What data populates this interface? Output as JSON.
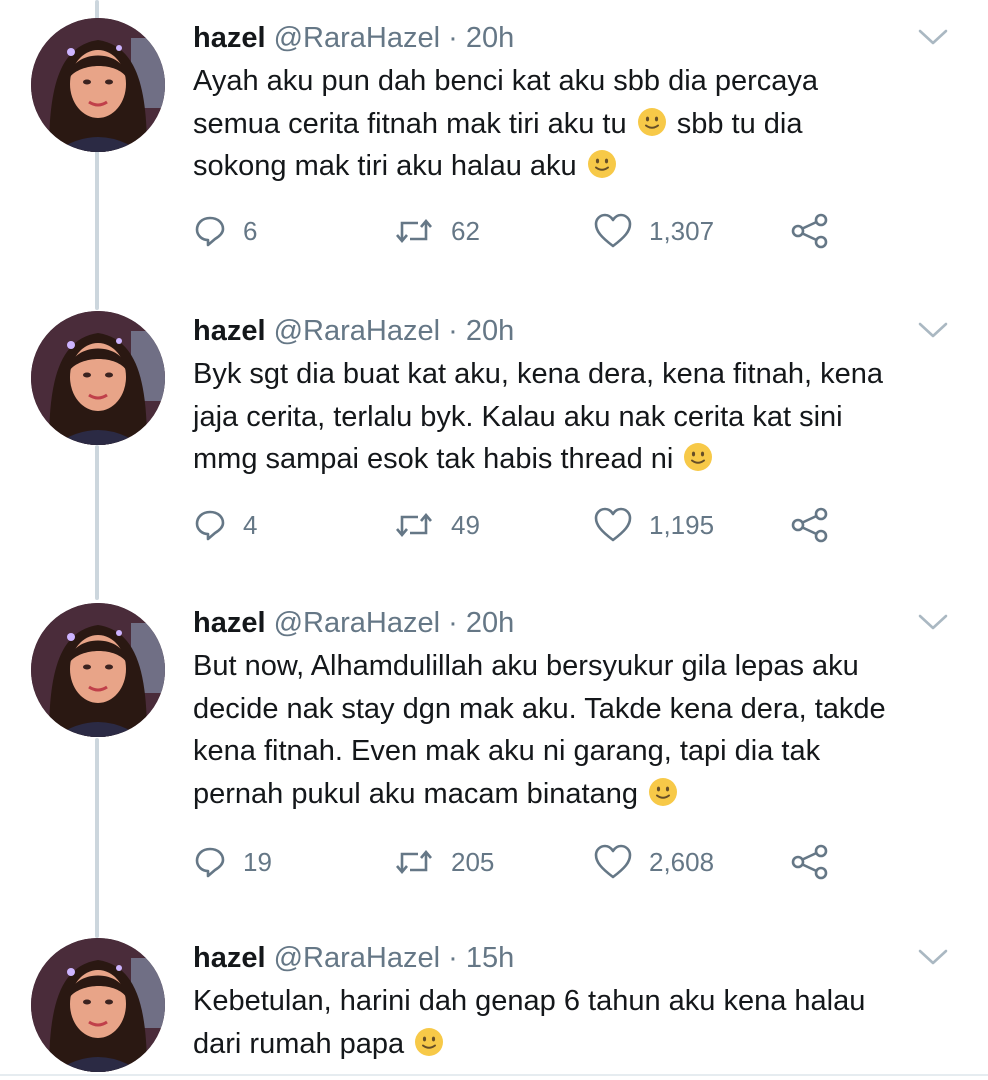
{
  "tweets": [
    {
      "name": "hazel",
      "handle": "@RaraHazel",
      "separator": "·",
      "time": "20h",
      "lines": [
        {
          "text": "Ayah aku pun dah benci kat aku sbb dia percaya",
          "emoji": "",
          "after": ""
        },
        {
          "text": "semua cerita fitnah mak tiri aku tu ",
          "emoji": "slightly-smiling-face",
          "after": " sbb tu dia"
        },
        {
          "text": "sokong mak tiri aku halau aku ",
          "emoji": "slightly-smiling-face",
          "after": ""
        }
      ],
      "replies": "6",
      "retweets": "62",
      "likes": "1,307"
    },
    {
      "name": "hazel",
      "handle": "@RaraHazel",
      "separator": "·",
      "time": "20h",
      "lines": [
        {
          "text": "Byk sgt dia buat kat aku, kena dera, kena fitnah, kena",
          "emoji": "",
          "after": ""
        },
        {
          "text": "jaja cerita, terlalu byk. Kalau aku nak cerita kat sini",
          "emoji": "",
          "after": ""
        },
        {
          "text": "mmg sampai esok tak habis thread ni ",
          "emoji": "slightly-smiling-face",
          "after": ""
        }
      ],
      "replies": "4",
      "retweets": "49",
      "likes": "1,195"
    },
    {
      "name": "hazel",
      "handle": "@RaraHazel",
      "separator": "·",
      "time": "20h",
      "lines": [
        {
          "text": "But now, Alhamdulillah aku bersyukur gila lepas aku",
          "emoji": "",
          "after": ""
        },
        {
          "text": "decide nak stay dgn mak aku. Takde kena dera, takde",
          "emoji": "",
          "after": ""
        },
        {
          "text": "kena fitnah. Even mak aku ni garang, tapi dia tak",
          "emoji": "",
          "after": ""
        },
        {
          "text": "pernah pukul aku macam binatang ",
          "emoji": "slightly-smiling-face",
          "after": ""
        }
      ],
      "replies": "19",
      "retweets": "205",
      "likes": "2,608"
    },
    {
      "name": "hazel",
      "handle": "@RaraHazel",
      "separator": "·",
      "time": "15h",
      "lines": [
        {
          "text": "Kebetulan, harini dah genap 6 tahun aku kena halau",
          "emoji": "",
          "after": ""
        },
        {
          "text": "dari rumah papa ",
          "emoji": "slightly-smiling-face",
          "after": ""
        }
      ],
      "replies": "",
      "retweets": "",
      "likes": ""
    }
  ],
  "icons": {
    "reply": "reply-icon",
    "retweet": "retweet-icon",
    "like": "heart-icon",
    "share": "share-icon",
    "menu": "chevron-down-icon"
  },
  "colors": {
    "text": "#14171a",
    "secondary": "#657786",
    "thread_line": "#ccd6dd",
    "emoji": "#f7c948"
  }
}
